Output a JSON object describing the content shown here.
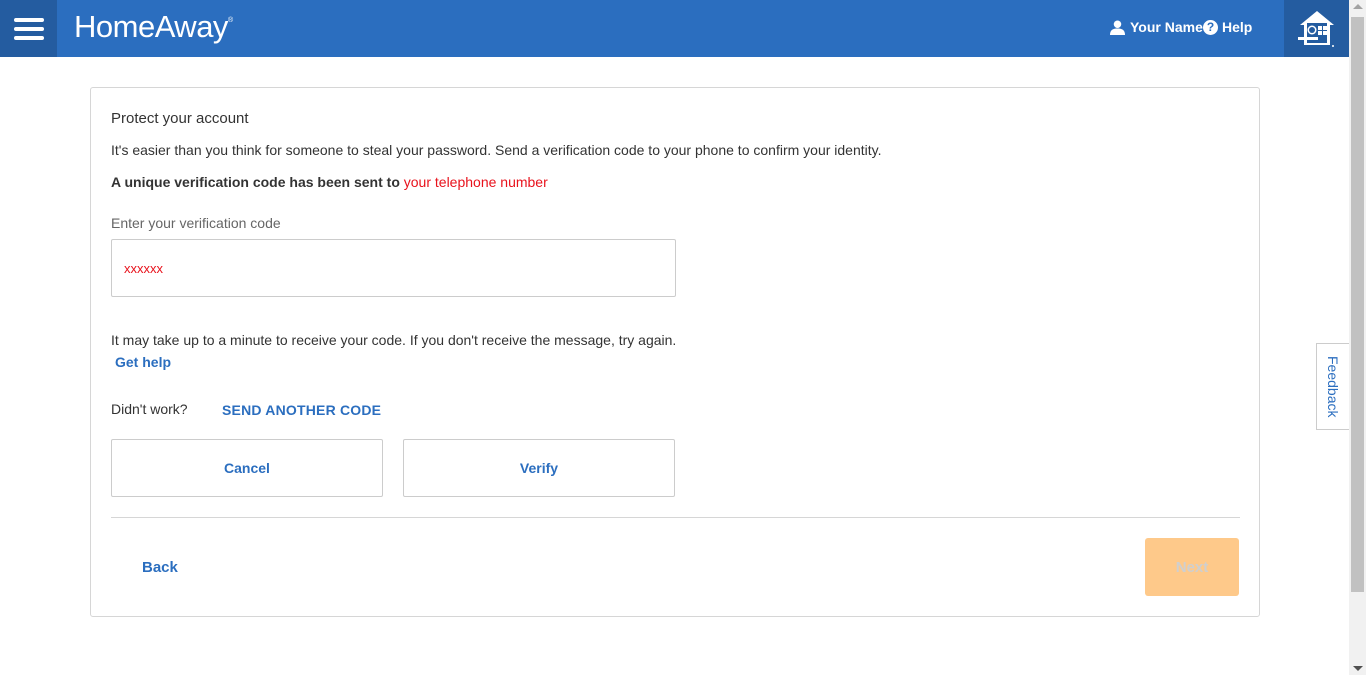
{
  "header": {
    "logo_text": "HomeAway",
    "logo_mark": "®",
    "user_label": "Your Name",
    "help_label": "Help",
    "help_glyph": "?",
    "brand_color": "#2b6ebf"
  },
  "card": {
    "title": "Protect your account",
    "description": "It's easier than you think for someone to steal your password. Send a verification code to your phone to confirm your identity.",
    "sent_prefix": "A unique verification code has been sent to ",
    "sent_target": "your telephone number",
    "code_label": "Enter your verification code",
    "code_value": "xxxxxx",
    "note_text": "It may take up to a minute to receive your code. If you don't receive the message, try again.",
    "get_help_label": "Get help",
    "didnt_work_label": "Didn't work?",
    "send_another_label": "SEND ANOTHER CODE",
    "cancel_label": "Cancel",
    "verify_label": "Verify",
    "back_label": "Back",
    "next_label": "Next"
  },
  "feedback": {
    "label": "Feedback"
  },
  "icons": {
    "menu": "hamburger-menu-icon",
    "user": "user-icon",
    "help": "help-circle-icon",
    "brand": "birdhouse-logo-icon"
  }
}
